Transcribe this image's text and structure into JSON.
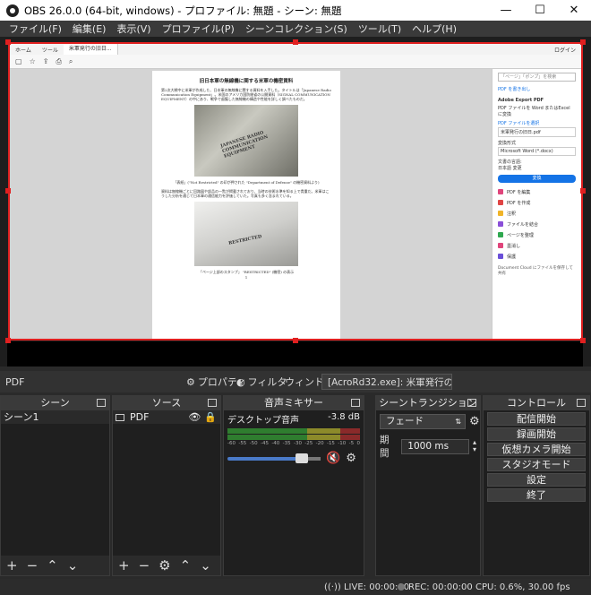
{
  "window": {
    "title": "OBS 26.0.0 (64-bit, windows) - プロファイル: 無題 - シーン: 無題",
    "minimize": "—",
    "maximize": "☐",
    "close": "✕"
  },
  "menu": [
    "ファイル(F)",
    "編集(E)",
    "表示(V)",
    "プロファイル(P)",
    "シーンコレクション(S)",
    "ツール(T)",
    "ヘルプ(H)"
  ],
  "capture": {
    "tabs": [
      "ホーム",
      "ツール",
      "米軍発行の旧日..."
    ],
    "tab_right": "ログイン",
    "doc_title": "旧日本軍の無線機に関する米軍の機密資料",
    "paragraph1": "第2次大戦中に米軍が作成した、日本軍の無線機に関する資料を入手した。タイトルは「Japanese Radio Communication Equipment」。米国のアメリカ国防総省の公開資料（SIGNAL COMMUNICATION EQUIPMENT）の中にあり、戦争で鹵獲した無線機の構造や性能を詳しく調べたものだ。",
    "stamp1": "JAPANESE RADIO COMMUNICATION EQUIPMENT",
    "caption1": "「表紙」(\"Not Restricted\" の印が押された \"Department of Defense\" の機密資料より)",
    "paragraph2": "資料は無線機ごとに回路図や部品の一覧が掲載されており、当時の技術水準を知る上で貴重だ。米軍はこうした分析を通じて日本軍の通信能力を評価していた。写真も多く含まれている。",
    "stamp2": "RESTRICTED",
    "caption2": "「ページ上部のスタンプ」 \"RESTRICTED\" (機密) の表示",
    "page_number": "1",
    "side": {
      "search": "「ページ」「ポンプ」を検索",
      "export_header": "PDF を書き出し",
      "adobe": "Adobe Export PDF",
      "desc": "PDF ファイルを Word またはExcel に変換",
      "file_label": "PDF ファイルを選択",
      "file": "米軍発行の旧日.pdf",
      "convert_label": "変換形式",
      "convert_value": "Microsoft Word (*.docx)",
      "lang_label": "文書の言語:",
      "lang_value": "日本語 変更",
      "convert_btn": "変換",
      "tools": [
        "PDF を編集",
        "PDF を作成",
        "注釈",
        "ファイルを結合",
        "ページを整理",
        "墨消し",
        "保護"
      ],
      "footer": "Document Cloud にファイルを保存して共有"
    }
  },
  "source_toolbar": {
    "name": "PDF",
    "properties": "プロパティ",
    "filters": "フィルタ",
    "window_label": "ウィンドウ",
    "window_value": "[AcroRd32.exe]: 米軍発行の旧日目"
  },
  "scenes": {
    "title": "シーン",
    "items": [
      "シーン1"
    ]
  },
  "sources": {
    "title": "ソース",
    "items": [
      "PDF"
    ]
  },
  "mixer": {
    "title": "音声ミキサー",
    "channel": "デスクトップ音声",
    "level": "-3.8 dB",
    "ticks": [
      "-60",
      "-55",
      "-50",
      "-45",
      "-40",
      "-35",
      "-30",
      "-25",
      "-20",
      "-15",
      "-10",
      "-5",
      "0"
    ],
    "volume": 0.8
  },
  "transitions": {
    "title": "シーントランジション",
    "type": "フェード",
    "duration_label": "期間",
    "duration": "1000 ms"
  },
  "controls": {
    "title": "コントロール",
    "buttons": [
      "配信開始",
      "録画開始",
      "仮想カメラ開始",
      "スタジオモード",
      "設定",
      "終了"
    ]
  },
  "status": {
    "live": "LIVE: 00:00:00",
    "rec": "REC: 00:00:00",
    "cpu": "CPU: 0.6%, 30.00 fps"
  }
}
